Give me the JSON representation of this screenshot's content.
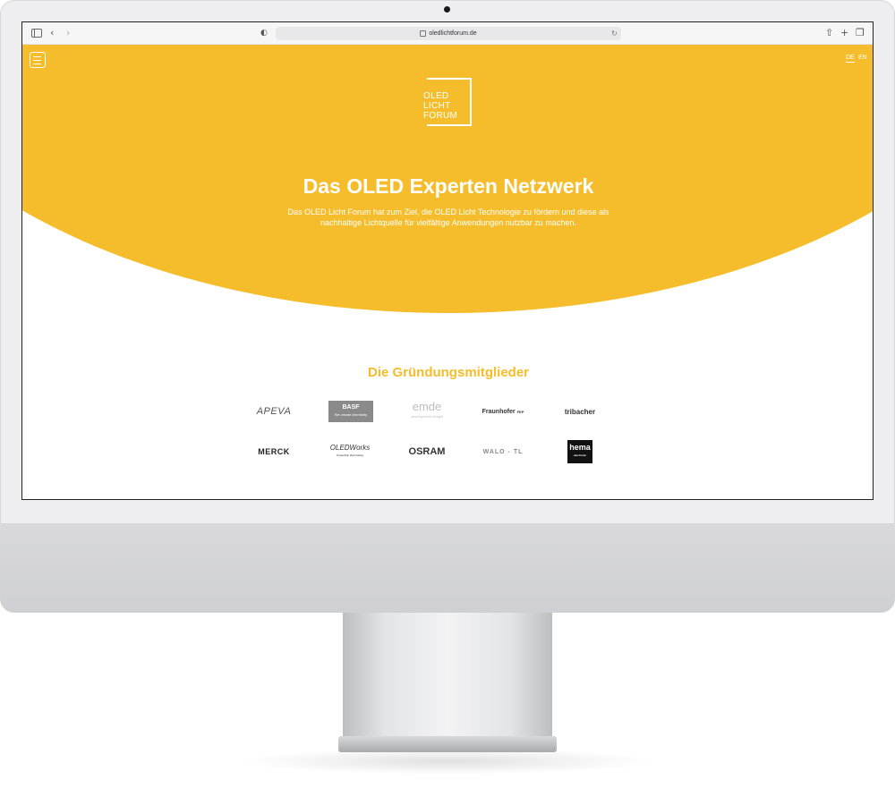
{
  "browser": {
    "url": "oledlichtforum.de"
  },
  "header": {
    "lang_de": "DE",
    "lang_en": "EN",
    "logo_lines": [
      "OLED",
      "LICHT",
      "FORUM"
    ]
  },
  "hero": {
    "title": "Das OLED Experten Netzwerk",
    "description": "Das OLED Licht Forum hat zum Ziel, die OLED Licht Technologie zu fördern und diese als nachhaltige Lichtquelle für vielfältige Anwendungen nutzbar zu machen."
  },
  "members": {
    "title": "Die Gründungsmitglieder",
    "logos": [
      {
        "name": "APEVA"
      },
      {
        "name": "BASF",
        "tagline": "We create chemistry"
      },
      {
        "name": "emde",
        "tagline": "development of light"
      },
      {
        "name": "Fraunhofer",
        "tagline": "FEP"
      },
      {
        "name": "tribacher"
      },
      {
        "name": "MERCK"
      },
      {
        "name": "OLEDWorks",
        "tagline": "Powerfully Illuminating"
      },
      {
        "name": "OSRAM"
      },
      {
        "name": "WALO - TL"
      },
      {
        "name": "hema",
        "tagline": "electronic"
      }
    ]
  },
  "colors": {
    "accent": "#f5bd2b",
    "monitor_frame": "#eeeef0"
  }
}
